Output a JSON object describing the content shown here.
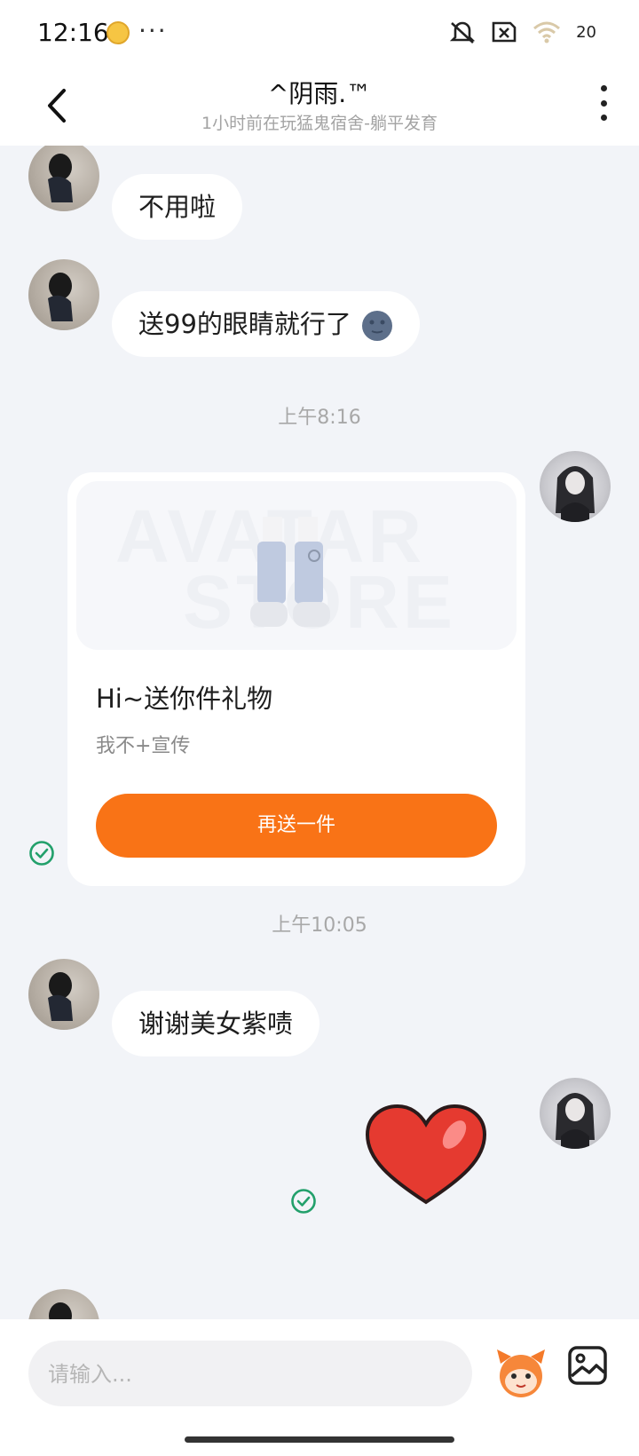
{
  "status_bar": {
    "time": "12:16",
    "more": "···",
    "battery": "20"
  },
  "header": {
    "title": "^阴雨.™",
    "subtitle": "1小时前在玩猛鬼宿舍-躺平发育"
  },
  "messages": [
    {
      "text": "不用啦"
    },
    {
      "text": "送99的眼睛就行了"
    }
  ],
  "timestamps": [
    "上午8:16",
    "上午10:05"
  ],
  "gift_card": {
    "title": "Hi~送你件礼物",
    "subtitle": "我不+宣传",
    "button_label": "再送一件",
    "watermark_top": "AVATAR",
    "watermark_bottom": "STORE"
  },
  "messages_later": [
    {
      "text": "谢谢美女紫啧"
    }
  ],
  "input": {
    "placeholder": "请输入..."
  },
  "colors": {
    "accent": "#f97316",
    "read_check": "#22a06b",
    "background": "#f2f4f8"
  }
}
